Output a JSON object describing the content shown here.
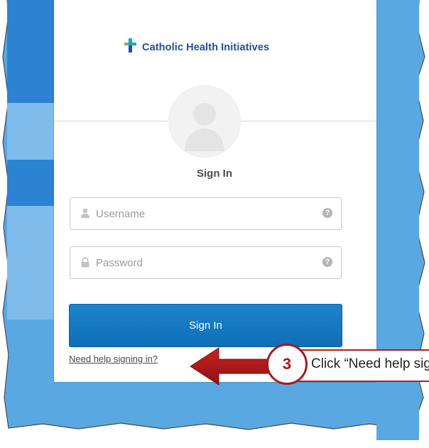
{
  "colors": {
    "background_blue": "#55a9e6",
    "primary_button": "#1478c2",
    "logo_blue": "#1f4ea1",
    "callout_red": "#b51d1d"
  },
  "logo": {
    "text": "Catholic Health Initiatives",
    "icon": "cross-logo-icon"
  },
  "avatar": {
    "icon": "user-silhouette-icon"
  },
  "form": {
    "title": "Sign In",
    "username": {
      "placeholder": "Username",
      "value": "",
      "icon": "user-icon",
      "help_icon": "question-icon",
      "help_text": "?"
    },
    "password": {
      "placeholder": "Password",
      "value": "",
      "icon": "lock-icon",
      "help_icon": "question-icon",
      "help_text": "?"
    },
    "submit_label": "Sign In",
    "help_link": "Need help signing in?"
  },
  "callout": {
    "step_number": "3",
    "text": "Click “Need help signing in?”",
    "arrow_icon": "left-arrow-icon"
  }
}
